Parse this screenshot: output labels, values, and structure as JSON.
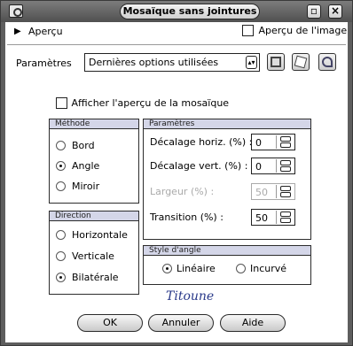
{
  "window": {
    "title": "Mosaïque sans jointures"
  },
  "preview": {
    "label": "Aperçu",
    "image_preview_label": "Aperçu de l'image"
  },
  "presets": {
    "label": "Paramètres",
    "value": "Dernières options utilisées"
  },
  "show_tile_preview": {
    "label": "Afficher l'aperçu de la mosaïque"
  },
  "method": {
    "title": "Méthode",
    "options": [
      "Bord",
      "Angle",
      "Miroir"
    ],
    "selected": "Angle"
  },
  "direction": {
    "title": "Direction",
    "options": [
      "Horizontale",
      "Verticale",
      "Bilatérale"
    ],
    "selected": "Bilatérale"
  },
  "params": {
    "title": "Paramètres",
    "h_offset_label": "Décalage horiz. (%) :",
    "h_offset_value": "0",
    "v_offset_label": "Décalage vert. (%) :",
    "v_offset_value": "0",
    "width_label": "Largeur (%) :",
    "width_value": "50",
    "transition_label": "Transition (%) :",
    "transition_value": "50"
  },
  "corner_style": {
    "title": "Style d'angle",
    "options": [
      "Linéaire",
      "Incurvé"
    ],
    "selected": "Linéaire"
  },
  "watermark": "Titoune",
  "buttons": {
    "ok": "OK",
    "cancel": "Annuler",
    "help": "Aide"
  }
}
